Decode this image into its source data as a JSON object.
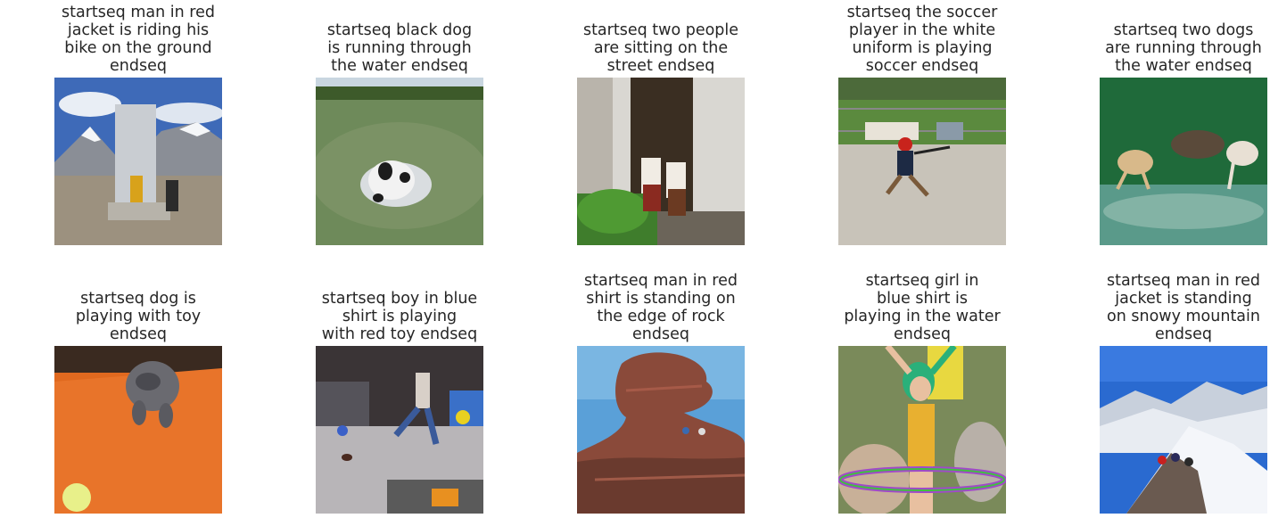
{
  "panels": [
    {
      "caption": [
        "startseq man in red",
        "jacket is riding his",
        "bike on the ground",
        "endseq"
      ]
    },
    {
      "caption": [
        "startseq black dog",
        "is running through",
        "the water endseq"
      ]
    },
    {
      "caption": [
        "startseq two people",
        "are sitting on the",
        "street endseq"
      ]
    },
    {
      "caption": [
        "startseq the soccer",
        "player in the white",
        "uniform is playing",
        "soccer endseq"
      ]
    },
    {
      "caption": [
        "startseq two dogs",
        "are running through",
        "the water endseq"
      ]
    },
    {
      "caption": [
        "startseq dog is",
        "playing with toy",
        "endseq"
      ]
    },
    {
      "caption": [
        "startseq boy in blue",
        "shirt is playing",
        "with red toy endseq"
      ]
    },
    {
      "caption": [
        "startseq man in red",
        "shirt is standing on",
        "the edge of rock",
        "endseq"
      ]
    },
    {
      "caption": [
        "startseq girl in",
        "blue shirt is",
        "playing in the water",
        "endseq"
      ]
    },
    {
      "caption": [
        "startseq man in red",
        "jacket is standing",
        "on snowy mountain",
        "endseq"
      ]
    }
  ]
}
